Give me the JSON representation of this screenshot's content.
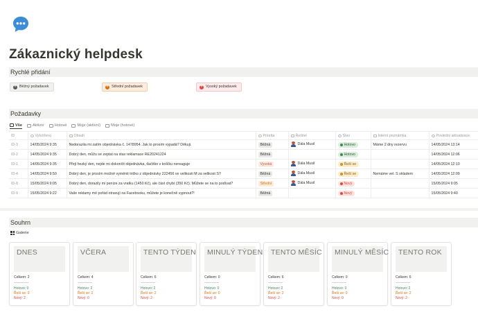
{
  "page": {
    "icon": "chat-bubble-icon",
    "title": "Zákaznický helpdesk"
  },
  "quick_add": {
    "heading": "Rychlé přidání",
    "buttons": [
      {
        "label": "Běžný požadavek",
        "color": "#5a5a57"
      },
      {
        "label": "Střední požadavek",
        "color": "#d9730d"
      },
      {
        "label": "Vysoký požadavek",
        "color": "#d44c47"
      }
    ]
  },
  "requests": {
    "heading": "Požadavky",
    "tabs": [
      {
        "label": "Vše",
        "active": true
      },
      {
        "label": "Aktivní"
      },
      {
        "label": "Hotové"
      },
      {
        "label": "Moje (aktivní)"
      },
      {
        "label": "Moje (hotové)"
      }
    ],
    "columns": [
      "ID",
      "Vytvořeno",
      "Obsah",
      "Priorita",
      "Řešitel",
      "Stav",
      "Interní poznámka",
      "Poslední aktualizace"
    ],
    "rows": [
      {
        "id": "ID-3",
        "created": "14/05/2024 9:35",
        "content": "Nedorazila mi zatím objednávka č. 1478954. Jak to prosím vypadá? Děkuji.",
        "priority": "Běžná",
        "priority_kind": "bezna",
        "assignee": "Dála Musil",
        "status": "Hotovo",
        "status_kind": "hotovo",
        "note": "Máme 2 dny rezervu",
        "updated": "14/05/2024 13:14"
      },
      {
        "id": "ID-2",
        "created": "14/05/2024 9:35",
        "content": "Dobrý den, můžu se zeptat na stav reklamace RE20241224",
        "priority": "Běžná",
        "priority_kind": "bezna",
        "assignee": "",
        "status": "Hotovo",
        "status_kind": "hotovo",
        "note": "",
        "updated": "14/05/2024 12:06"
      },
      {
        "id": "ID-1",
        "created": "14/05/2024 9:35",
        "content": "Přeji hezký den, nejde mi dokončit objednávka, tlačítko v košíku nereaguje",
        "priority": "Vysoká",
        "priority_kind": "vysoka",
        "assignee": "Dála Musil",
        "status": "Řeší se",
        "status_kind": "resi",
        "note": "",
        "updated": "14/05/2024 12:10"
      },
      {
        "id": "ID-4",
        "created": "14/05/2024 9:50",
        "content": "Dobrý den, je prosím možné vyměnit tričko z objednávky 222456 ve velikosti M za velikost S?",
        "priority": "Běžná",
        "priority_kind": "bezna",
        "assignee": "Dála Musil",
        "status": "Řeší se",
        "status_kind": "resi",
        "note": "Nemáme vel. S skladem",
        "updated": "14/05/2024 12:09"
      },
      {
        "id": "ID-8",
        "created": "15/05/2024 9:05",
        "content": "Dobrý den, dorazily mi peníze za vratku (1450 Kč), ale část chybí (350 Kč). Můžete se na to podívat?",
        "priority": "Střední",
        "priority_kind": "stredni",
        "assignee": "Dála Musil",
        "status": "Nový",
        "status_kind": "novy",
        "note": "",
        "updated": "15/05/2024 9:05"
      },
      {
        "id": "ID-9",
        "created": "15/05/2024 9:22",
        "content": "Vaše reklamy mě pořád otravují na Facebooku, můžete je konečně vypnout?!",
        "priority": "Běžná",
        "priority_kind": "bezna",
        "assignee": "",
        "status": "Nový",
        "status_kind": "novy",
        "note": "",
        "updated": "15/05/2024 9:40"
      }
    ]
  },
  "summary": {
    "heading": "Souhrn",
    "view_label": "Galerie",
    "cards": [
      {
        "title": "DNES",
        "total": "Celkem: 2",
        "done": "Hotovo: 0",
        "in_progress": "Řeší se: 0",
        "new": "Nový: 2"
      },
      {
        "title": "VČERA",
        "total": "Celkem: 4",
        "done": "Hotovo: 2",
        "in_progress": "Řeší se: 2",
        "new": "Nový: 0"
      },
      {
        "title": "TENTO TÝDEN",
        "total": "Celkem: 6",
        "done": "Hotovo: 2",
        "in_progress": "Řeší se: 2",
        "new": "Nový: 2"
      },
      {
        "title": "MINULÝ TÝDEN",
        "total": "Celkem: 0",
        "done": "Hotovo: 0",
        "in_progress": "Řeší se: 0",
        "new": "Nový: 0"
      },
      {
        "title": "TENTO MĚSÍC",
        "total": "Celkem: 6",
        "done": "Hotovo: 2",
        "in_progress": "Řeší se: 2",
        "new": "Nový: 2"
      },
      {
        "title": "MINULÝ MĚSÍC",
        "total": "Celkem: 0",
        "done": "Hotovo: 0",
        "in_progress": "Řeší se: 0",
        "new": "Nový: 0"
      },
      {
        "title": "TENTO ROK",
        "total": "Celkem: 6",
        "done": "Hotovo: 2",
        "in_progress": "Řeší se: 2",
        "new": "Nový: 2"
      }
    ],
    "separator": "------------------"
  }
}
